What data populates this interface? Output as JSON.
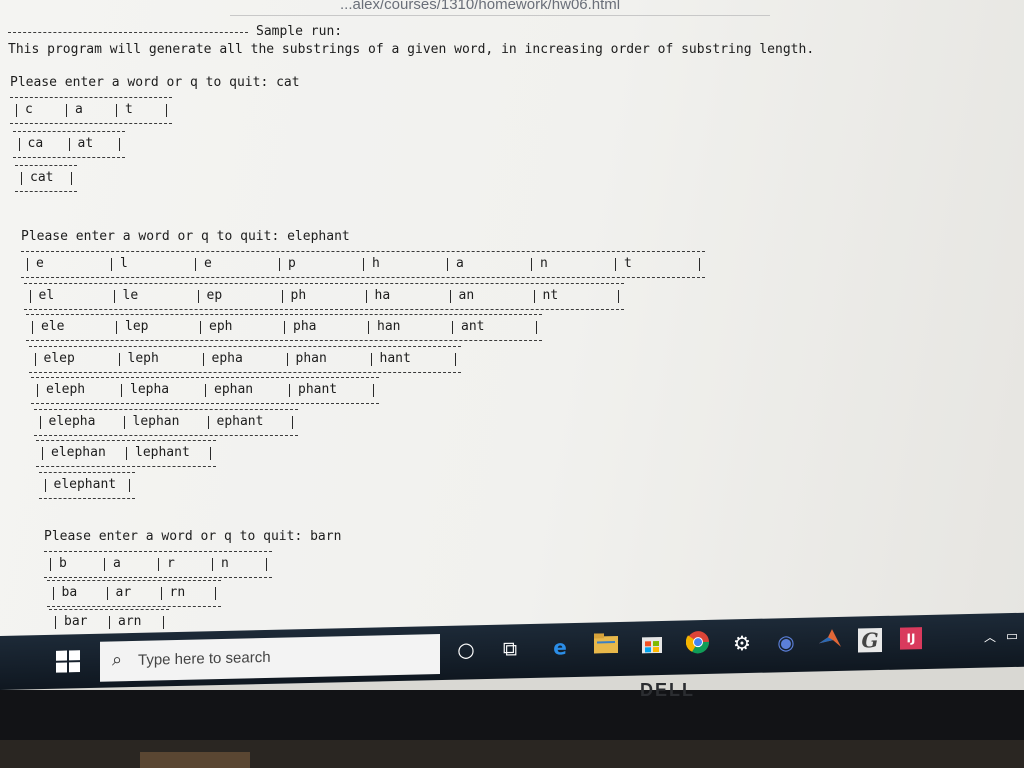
{
  "browser": {
    "url": "...alex/courses/1310/homework/hw06.html"
  },
  "document": {
    "header": "Sample run:",
    "intro": "This program will generate all the substrings of a given word, in increasing order of substring length.",
    "runs": [
      {
        "prompt": "Please enter a word or q to quit: cat",
        "rows": [
          [
            "c",
            "a",
            "t"
          ],
          [
            "ca",
            "at"
          ],
          [
            "cat"
          ]
        ]
      },
      {
        "prompt": "Please enter a word or q to quit: elephant",
        "rows": [
          [
            "e",
            "l",
            "e",
            "p",
            "h",
            "a",
            "n",
            "t"
          ],
          [
            "el",
            "le",
            "ep",
            "ph",
            "ha",
            "an",
            "nt"
          ],
          [
            "ele",
            "lep",
            "eph",
            "pha",
            "han",
            "ant"
          ],
          [
            "elep",
            "leph",
            "epha",
            "phan",
            "hant"
          ],
          [
            "eleph",
            "lepha",
            "ephan",
            "phant"
          ],
          [
            "elepha",
            "lephan",
            "ephant"
          ],
          [
            "elephan",
            "lephant"
          ],
          [
            "elephant"
          ]
        ]
      },
      {
        "prompt": "Please enter a word or q to quit: barn",
        "rows": [
          [
            "b",
            "a",
            "r",
            "n"
          ],
          [
            "ba",
            "ar",
            "rn"
          ],
          [
            "bar",
            "arn"
          ]
        ]
      }
    ]
  },
  "taskbar": {
    "search_placeholder": "Type here to search",
    "icons": [
      "windows-start-icon",
      "search-icon",
      "cortana-circle-icon",
      "task-view-icon",
      "edge-icon",
      "file-explorer-icon",
      "store-icon",
      "chrome-icon",
      "settings-gear-icon",
      "eclipse-icon",
      "matlab-icon",
      "greenfoot-icon",
      "intellij-icon"
    ],
    "tray": [
      "chevron-up-icon",
      "battery-icon"
    ]
  },
  "hardware": {
    "brand": "DELL"
  }
}
